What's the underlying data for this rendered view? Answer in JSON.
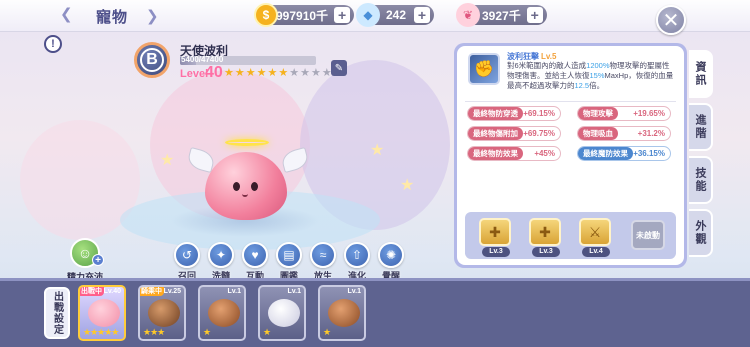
{
  "topbar": {
    "title": "寵物",
    "currencies": [
      {
        "icon": "gold-coin-icon",
        "value": "997910千",
        "color": "#f5b21e"
      },
      {
        "icon": "diamond-icon",
        "value": "242",
        "color": "#9fd0ff"
      },
      {
        "icon": "feather-token-icon",
        "value": "3927千",
        "color": "#ff8aa8"
      }
    ],
    "plus": "+",
    "close": "✕"
  },
  "pet": {
    "grade": "B",
    "name": "天使波利",
    "exp": "5400/47400",
    "exp_fraction": 0.114,
    "level_label": "Level",
    "level": "40",
    "stars_filled": 6,
    "stars_total": 10
  },
  "feed": {
    "label": "精力充沛",
    "plus": "+"
  },
  "actions": [
    {
      "icon": "recall-icon",
      "label": "召回"
    },
    {
      "icon": "wash-icon",
      "label": "洗髓"
    },
    {
      "icon": "interact-icon",
      "label": "互動"
    },
    {
      "icon": "codex-icon",
      "label": "圖鑑"
    },
    {
      "icon": "release-icon",
      "label": "放生"
    },
    {
      "icon": "evolve-icon",
      "label": "進化"
    },
    {
      "icon": "awaken-icon",
      "label": "覺醒"
    }
  ],
  "skill": {
    "name": "波利狂擊",
    "level": "Lv.5",
    "desc_1": "對6米範圍內的敵人造成",
    "desc_hl_1": "1200%",
    "desc_2": "物理攻擊的聖屬性物理傷害。並給主人恢復",
    "desc_hl_2": "15%",
    "desc_3": "MaxHp，恢復的血量最高不超過攻擊力的",
    "desc_hl_3": "12.5",
    "desc_4": "倍。"
  },
  "stats": [
    {
      "key": "最終物防穿透",
      "value": "+69.15%",
      "tone": "red"
    },
    {
      "key": "物理攻擊",
      "value": "+19.65%",
      "tone": "red"
    },
    {
      "key": "最終物傷附加",
      "value": "+69.75%",
      "tone": "red"
    },
    {
      "key": "物理吸血",
      "value": "+31.2%",
      "tone": "red"
    },
    {
      "key": "最終物防效果",
      "value": "+45%",
      "tone": "red"
    },
    {
      "key": "最終魔防效果",
      "value": "+36.15%",
      "tone": "blue"
    }
  ],
  "runes": [
    {
      "level": "Lv.3"
    },
    {
      "level": "Lv.3"
    },
    {
      "level": "Lv.4"
    }
  ],
  "rune_inactive": "未啟動",
  "tabs": [
    {
      "label": "資訊",
      "active": true
    },
    {
      "label": "進階",
      "active": false
    },
    {
      "label": "技能",
      "active": false
    },
    {
      "label": "外觀",
      "active": false
    }
  ],
  "bottom": {
    "battle_set_label": "出戰設定",
    "slots": [
      {
        "level": "Lv.40",
        "tag": "出戰中",
        "stars": "★★★★★",
        "color": "#f28fa8",
        "selected": true
      },
      {
        "level": "Lv.25",
        "tag": "騎乘中",
        "stars": "★★★",
        "color": "#a46a3e",
        "selected": false
      },
      {
        "level": "Lv.1",
        "tag": "",
        "stars": "★",
        "color": "#b86a3a",
        "selected": false
      },
      {
        "level": "Lv.1",
        "tag": "",
        "stars": "★",
        "color": "#f3f3fb",
        "selected": false
      },
      {
        "level": "Lv.1",
        "tag": "",
        "stars": "★",
        "color": "#b86a3a",
        "selected": false
      }
    ]
  }
}
